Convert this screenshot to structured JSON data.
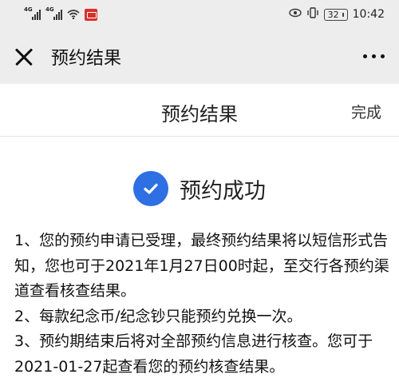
{
  "status_bar": {
    "net1": "4G",
    "net2": "4G",
    "battery": "32",
    "time": "10:42"
  },
  "title_bar": {
    "title": "预约结果"
  },
  "page_header": {
    "title": "预约结果",
    "done_label": "完成"
  },
  "result": {
    "status_text": "预约成功",
    "accent_color": "#2f6fe4"
  },
  "notes": [
    "1、您的预约申请已受理，最终预约结果将以短信形式告知，您也可于2021年1月27日00时起，至交行各预约渠道查看核查结果。",
    "2、每款纪念币/纪念钞只能预约兑换一次。",
    "3、预约期结束后将对全部预约信息进行核查。您可于2021-01-27起查看您的预约核查结果。"
  ]
}
